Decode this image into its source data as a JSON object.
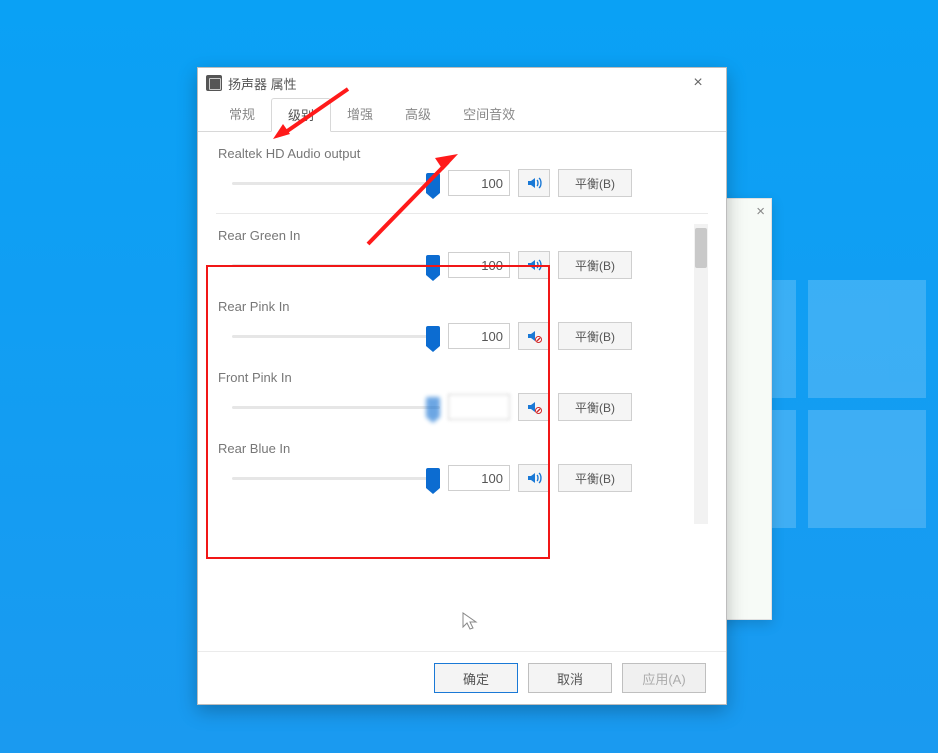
{
  "window": {
    "title": "扬声器 属性"
  },
  "tabs": {
    "items": [
      {
        "label": "常规"
      },
      {
        "label": "级别"
      },
      {
        "label": "增强"
      },
      {
        "label": "高级"
      },
      {
        "label": "空间音效"
      }
    ],
    "active_index": 1
  },
  "balance_label": "平衡(B)",
  "main_output": {
    "label": "Realtek HD Audio output",
    "value": "100",
    "muted": false
  },
  "inputs": [
    {
      "label": "Rear Green In",
      "value": "100",
      "muted": false
    },
    {
      "label": "Rear Pink In",
      "value": "100",
      "muted": true
    },
    {
      "label": "Front Pink In",
      "value": "",
      "muted": true,
      "blurred": true
    },
    {
      "label": "Rear Blue In",
      "value": "100",
      "muted": false
    }
  ],
  "buttons": {
    "ok": "确定",
    "cancel": "取消",
    "apply": "应用(A)"
  }
}
